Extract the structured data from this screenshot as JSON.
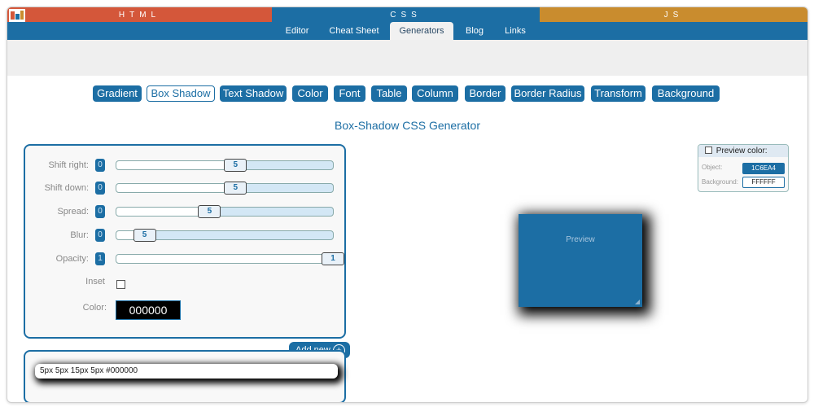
{
  "topbar": {
    "html_label": "HTML",
    "css_label": "CSS",
    "js_label": "JS"
  },
  "nav": {
    "items": [
      {
        "label": "Editor"
      },
      {
        "label": "Cheat Sheet"
      },
      {
        "label": "Generators",
        "active": true
      },
      {
        "label": "Blog"
      },
      {
        "label": "Links"
      }
    ]
  },
  "generator_tabs": [
    {
      "label": "Gradient"
    },
    {
      "label": "Box Shadow",
      "active": true
    },
    {
      "label": "Text Shadow"
    },
    {
      "label": "Color"
    },
    {
      "label": "Font"
    },
    {
      "label": "Table"
    },
    {
      "label": "Column"
    },
    {
      "label": "Border"
    },
    {
      "label": "Border Radius"
    },
    {
      "label": "Transform"
    },
    {
      "label": "Background"
    }
  ],
  "page_title": "Box-Shadow CSS Generator",
  "controls": {
    "shift_right": {
      "label": "Shift right:",
      "min_label": "0",
      "value": "5",
      "fraction": 0.55
    },
    "shift_down": {
      "label": "Shift down:",
      "min_label": "0",
      "value": "5",
      "fraction": 0.55
    },
    "spread": {
      "label": "Spread:",
      "min_label": "0",
      "value": "5",
      "fraction": 0.43
    },
    "blur": {
      "label": "Blur:",
      "min_label": "0",
      "value": "5",
      "fraction": 0.13
    },
    "opacity": {
      "label": "Opacity:",
      "min_label": "1",
      "value": "1",
      "fraction": 1.0
    },
    "inset": {
      "label": "Inset",
      "checked": false
    },
    "color": {
      "label": "Color:",
      "value": "000000"
    }
  },
  "add_new": {
    "label": "Add new"
  },
  "shadow_code": "5px 5px 15px 5px #000000",
  "preview": {
    "label": "Preview",
    "box_color": "#1C6EA4"
  },
  "preview_color": {
    "header": "Preview color:",
    "checked": false,
    "object_label": "Object:",
    "object_value": "1C6EA4",
    "background_label": "Background:",
    "background_value": "FFFFFF"
  },
  "colors": {
    "brand_blue": "#1C6EA4",
    "html_red": "#D4573A",
    "js_gold": "#C98C2E"
  }
}
